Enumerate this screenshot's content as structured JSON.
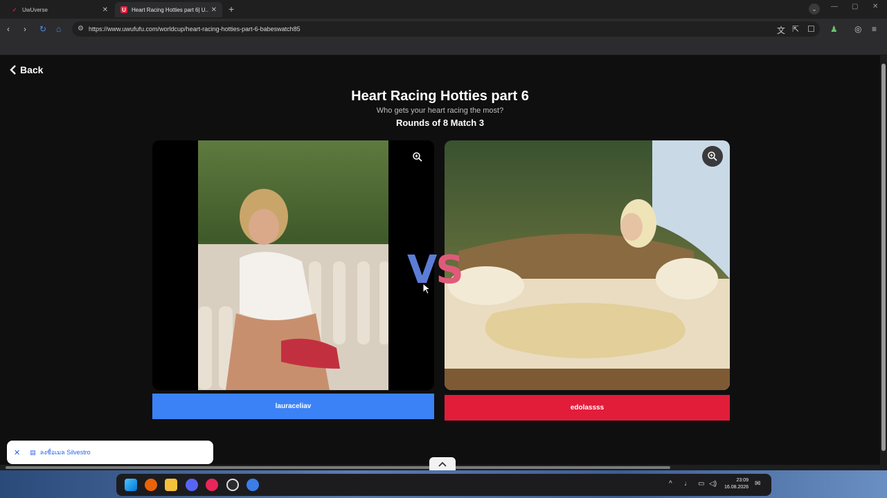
{
  "browser": {
    "tabs": [
      {
        "title": "UwUverse",
        "active": false
      },
      {
        "title": "Heart Racing Hotties part 6| U...",
        "active": true
      }
    ],
    "new_tab": "+",
    "url": "https://www.uwufufu.com/worldcup/heart-racing-hotties-part-6-babeswatch85"
  },
  "page": {
    "back_label": "Back",
    "title": "Heart Racing Hotties part 6",
    "subtitle": "Who gets your heart racing the most?",
    "round_info": "Rounds of 8 Match 3",
    "vs_v": "V",
    "vs_s": "S",
    "contestants": [
      {
        "name": "lauraceliav",
        "color": "#3b82f6"
      },
      {
        "name": "edolassss",
        "color": "#e11d3a"
      }
    ]
  },
  "notification": {
    "text": "ลงชื่อเมล Silvestro"
  },
  "taskbar": {
    "time": "23:09",
    "date": "16.08.2026"
  }
}
